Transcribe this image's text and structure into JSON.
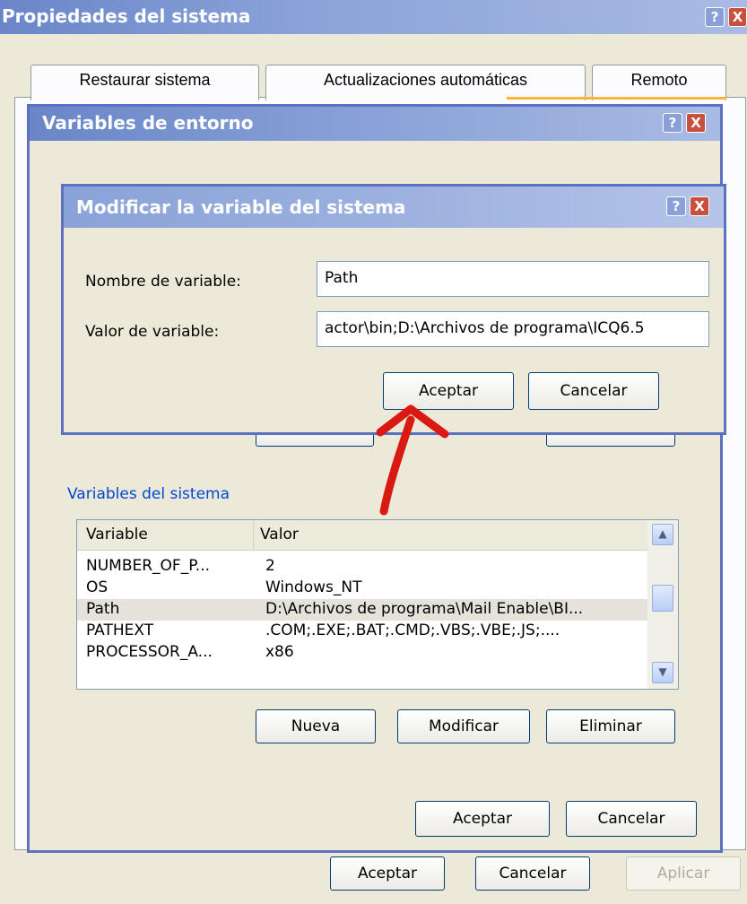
{
  "outer": {
    "title": "Propiedades del sistema",
    "tabs": [
      "Restaurar sistema",
      "Actualizaciones automáticas",
      "Remoto"
    ],
    "buttons": {
      "ok": "Aceptar",
      "cancel": "Cancelar",
      "apply": "Aplicar"
    }
  },
  "env": {
    "title": "Variables de entorno",
    "system_vars_label": "Variables del sistema",
    "columns": [
      "Variable",
      "Valor"
    ],
    "rows": [
      {
        "name": "NUMBER_OF_P...",
        "value": "2"
      },
      {
        "name": "OS",
        "value": "Windows_NT"
      },
      {
        "name": "Path",
        "value": "D:\\Archivos de programa\\Mail Enable\\BI..."
      },
      {
        "name": "PATHEXT",
        "value": ".COM;.EXE;.BAT;.CMD;.VBS;.VBE;.JS;...."
      },
      {
        "name": "PROCESSOR_A...",
        "value": "x86"
      }
    ],
    "selected_row": 2,
    "buttons": {
      "new": "Nueva",
      "modify": "Modificar",
      "delete": "Eliminar",
      "ok": "Aceptar",
      "cancel": "Cancelar"
    }
  },
  "modify": {
    "title": "Modificar la variable del sistema",
    "name_label": "Nombre de variable:",
    "name_value": "Path",
    "value_label": "Valor de variable:",
    "value_value": "actor\\bin;D:\\Archivos de programa\\ICQ6.5",
    "buttons": {
      "ok": "Aceptar",
      "cancel": "Cancelar"
    }
  },
  "icons": {
    "help": "?",
    "close": "X",
    "scroll_up": "▲",
    "scroll_down": "▼"
  },
  "colors": {
    "annotation_arrow": "#d81a12",
    "title_bar": "#7d95d0",
    "link_blue": "#0046d5"
  }
}
